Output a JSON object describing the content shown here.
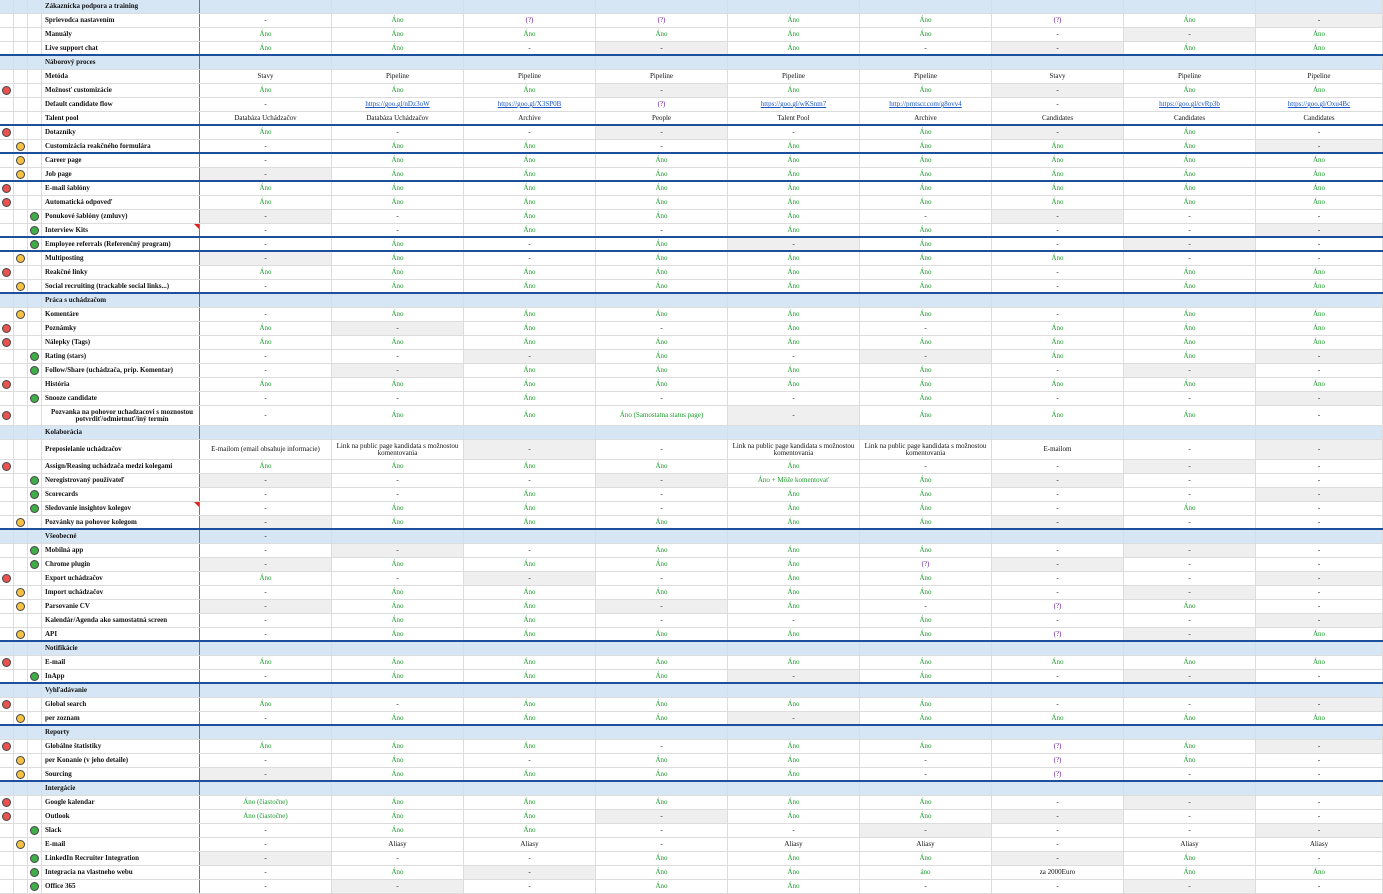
{
  "sheet": {
    "rows": [
      {
        "label": "Zákaznícka podpora a training",
        "section": true,
        "border": false,
        "values": []
      },
      {
        "label": "Sprievodca nastavením",
        "dot": "",
        "values": [
          "-",
          "Áno",
          "(?)",
          "(?)",
          "Áno",
          "Áno",
          "(?)",
          "Áno",
          "-"
        ]
      },
      {
        "label": "Manuály",
        "dot": "",
        "values": [
          "Áno",
          "Áno",
          "Áno",
          "Áno",
          "Áno",
          "Áno",
          "-",
          "-",
          "Áno"
        ]
      },
      {
        "label": "Live support chat",
        "dot": "",
        "border": true,
        "values": [
          "Áno",
          "Áno",
          "-",
          "-",
          "Áno",
          "-",
          "-",
          "Áno",
          "Áno"
        ]
      },
      {
        "label": "Náborový proces",
        "section": true,
        "values": []
      },
      {
        "label": "Metóda",
        "dot": "",
        "values": [
          "Stavy",
          "Pipeline",
          "Pipeline",
          "Pipeline",
          "Pipeline",
          "Pipeline",
          "Stavy",
          "Pipeline",
          "Pipeline"
        ]
      },
      {
        "label": "Možnosť customizácie",
        "dot": "red",
        "values": [
          "Áno",
          "Áno",
          "Áno",
          "-",
          "Áno",
          "Áno",
          "-",
          "Áno",
          "Áno"
        ]
      },
      {
        "label": "Default candidate flow",
        "dot": "",
        "values": [
          "-",
          "https://goo.gl/nDz3oW",
          "https://goo.gl/X3SP0B",
          "(?)",
          "https://goo.gl/wKSnm7",
          "http://prntscr.com/g8ovv4",
          "-",
          "https://goo.gl/cvRp3b",
          "https://goo.gl/Oxu4Bc"
        ]
      },
      {
        "label": "Talent pool",
        "dot": "",
        "border": true,
        "values": [
          "Databáza Uchádzačov",
          "Databáza Uchádzačov",
          "Archive",
          "People",
          "Talent Pool",
          "Archive",
          "Candidates",
          "Candidates",
          "Candidates"
        ]
      },
      {
        "label": "Dotazníky",
        "dot": "red",
        "values": [
          "Áno",
          "-",
          "-",
          "-",
          "-",
          "Áno",
          "-",
          "Áno",
          "-"
        ]
      },
      {
        "label": "Customizácia reakčného formulára",
        "dot": "yellow",
        "border": true,
        "values": [
          "-",
          "Áno",
          "Áno",
          "-",
          "Áno",
          "Áno",
          "Áno",
          "Áno",
          "-"
        ]
      },
      {
        "label": "Career page",
        "dot": "yellow",
        "values": [
          "-",
          "Áno",
          "Áno",
          "Áno",
          "Áno",
          "Áno",
          "Áno",
          "Áno",
          "Áno"
        ]
      },
      {
        "label": "Job page",
        "dot": "yellow",
        "border": true,
        "values": [
          "-",
          "Áno",
          "Áno",
          "Áno",
          "Áno",
          "Áno",
          "Áno",
          "Áno",
          "Áno"
        ]
      },
      {
        "label": "E-mail šablóny",
        "dot": "red",
        "values": [
          "Áno",
          "Áno",
          "Áno",
          "Áno",
          "Áno",
          "Áno",
          "Áno",
          "Áno",
          "Áno"
        ]
      },
      {
        "label": "Automatická odpoveď",
        "dot": "red",
        "values": [
          "Áno",
          "Áno",
          "Áno",
          "Áno",
          "Áno",
          "Áno",
          "Áno",
          "Áno",
          "Áno"
        ]
      },
      {
        "label": "Ponukové šablóny (zmluvy)",
        "dot": "green",
        "values": [
          "-",
          "-",
          "Áno",
          "Áno",
          "Áno",
          "-",
          "-",
          "-",
          "-"
        ]
      },
      {
        "label": "Interview Kits",
        "dot": "green",
        "comment": true,
        "border": true,
        "values": [
          "-",
          "-",
          "Áno",
          "-",
          "Áno",
          "Áno",
          "-",
          "-",
          "-"
        ]
      },
      {
        "label": "Employee referrals (Referenčný program)",
        "dot": "green",
        "border": true,
        "values": [
          "-",
          "Áno",
          "-",
          "Áno",
          "-",
          "Áno",
          "-",
          "-",
          "-"
        ]
      },
      {
        "label": "Multiposting",
        "dot": "yellow",
        "values": [
          "-",
          "Áno",
          "-",
          "Áno",
          "Áno",
          "Áno",
          "Áno",
          "-",
          "-"
        ]
      },
      {
        "label": "Reakčné linky",
        "dot": "red",
        "values": [
          "Áno",
          "Áno",
          "Áno",
          "Áno",
          "Áno",
          "Áno",
          "-",
          "Áno",
          "Áno"
        ]
      },
      {
        "label": "Social recruiting (trackable social links...)",
        "dot": "yellow",
        "border": true,
        "values": [
          "-",
          "Áno",
          "Áno",
          "Áno",
          "Áno",
          "Áno",
          "-",
          "Áno",
          "Áno"
        ]
      },
      {
        "label": "Práca s uchádzačom",
        "section": true,
        "values": []
      },
      {
        "label": "Komentáre",
        "dot": "yellow",
        "values": [
          "-",
          "Áno",
          "Áno",
          "Áno",
          "Áno",
          "Áno",
          "-",
          "Áno",
          "Áno"
        ]
      },
      {
        "label": "Poznámky",
        "dot": "red",
        "values": [
          "Áno",
          "-",
          "Áno",
          "-",
          "Áno",
          "-",
          "Áno",
          "Áno",
          "Áno"
        ]
      },
      {
        "label": "Nálepky (Tags)",
        "dot": "red",
        "values": [
          "Áno",
          "Áno",
          "Áno",
          "Áno",
          "Áno",
          "Áno",
          "Áno",
          "Áno",
          "Áno"
        ]
      },
      {
        "label": "Rating (stars)",
        "dot": "green",
        "values": [
          "-",
          "-",
          "-",
          "Áno",
          "-",
          "-",
          "Áno",
          "Áno",
          "-"
        ]
      },
      {
        "label": "Follow/Share (uchádzača, príp. Komentar)",
        "dot": "green",
        "values": [
          "-",
          "-",
          "Áno",
          "Áno",
          "Áno",
          "Áno",
          "-",
          "-",
          "-"
        ]
      },
      {
        "label": "História",
        "dot": "red",
        "values": [
          "Áno",
          "Áno",
          "Áno",
          "Áno",
          "Áno",
          "Áno",
          "Áno",
          "Áno",
          "Áno"
        ]
      },
      {
        "label": "Snooze candidate",
        "dot": "green",
        "values": [
          "-",
          "-",
          "Áno",
          "-",
          "-",
          "Áno",
          "-",
          "-",
          "-"
        ]
      },
      {
        "label": "Pozvanka na pohovor uchadzacovi s moznostou potvrdiť/odmietnuť/iný termín",
        "dot": "red",
        "tall": true,
        "values": [
          "-",
          "Áno",
          "Áno",
          "Áno (Samostatna status page)",
          "-",
          "Áno",
          "Áno",
          "Áno",
          "-"
        ]
      },
      {
        "label": "Kolaborácia",
        "section": true,
        "values": []
      },
      {
        "label": "Preposielanie uchádzačov",
        "dot": "",
        "tall": true,
        "values": [
          "E-mailom (email obsahuje informacie)",
          "Link na public page kandidata s možnostou komentovania",
          "-",
          "-",
          "Link na public page kandidata s možnostou komentovania",
          "Link na public page kandidata s možnostou komentovania",
          "E-mailom",
          "-",
          "-"
        ]
      },
      {
        "label": "Assign/Reasing uchádzača medzi kolegami",
        "dot": "red",
        "values": [
          "Áno",
          "Áno",
          "Áno",
          "Áno",
          "Áno",
          "-",
          "-",
          "-",
          "-"
        ]
      },
      {
        "label": "Neregistrovaný používateľ",
        "dot": "green",
        "values": [
          "-",
          "-",
          "-",
          "-",
          "Áno + Môže komentovať",
          "Áno",
          "-",
          "-",
          "-"
        ]
      },
      {
        "label": "Scorecards",
        "dot": "green",
        "values": [
          "-",
          "-",
          "Áno",
          "-",
          "Áno",
          "Áno",
          "-",
          "-",
          "-"
        ]
      },
      {
        "label": "Sledovanie insightov kolegov",
        "dot": "green",
        "comment": true,
        "values": [
          "-",
          "Áno",
          "Áno",
          "-",
          "Áno",
          "Áno",
          "-",
          "Áno",
          "-"
        ]
      },
      {
        "label": "Pozvánky na pohovor kolegom",
        "dot": "yellow",
        "border": true,
        "values": [
          "-",
          "Áno",
          "Áno",
          "Áno",
          "Áno",
          "Áno",
          "-",
          "-",
          "-"
        ]
      },
      {
        "label": "Všeobecné",
        "section": true,
        "values": [
          "-"
        ]
      },
      {
        "label": "Mobilná app",
        "dot": "green",
        "values": [
          "-",
          "-",
          "-",
          "Áno",
          "Áno",
          "Áno",
          "-",
          "-",
          "-"
        ]
      },
      {
        "label": "Chrome plugin",
        "dot": "green",
        "values": [
          "-",
          "Áno",
          "Áno",
          "Áno",
          "Áno",
          "(?)",
          "-",
          "-",
          "-"
        ]
      },
      {
        "label": "Export uchádzačov",
        "dot": "red",
        "values": [
          "Áno",
          "-",
          "-",
          "-",
          "Áno",
          "Áno",
          "-",
          "-",
          "-"
        ]
      },
      {
        "label": "Import uchádzačov",
        "dot": "yellow",
        "values": [
          "-",
          "Áno",
          "Áno",
          "Áno",
          "Áno",
          "Áno",
          "-",
          "-",
          "-"
        ]
      },
      {
        "label": "Parsovanie CV",
        "dot": "yellow",
        "values": [
          "-",
          "Áno",
          "Áno",
          "-",
          "Áno",
          "-",
          "(?)",
          "Áno",
          "-"
        ]
      },
      {
        "label": "Kalendár/Agenda ako samostatná screen",
        "dot": "",
        "values": [
          "-",
          "Áno",
          "Áno",
          "-",
          "-",
          "Áno",
          "-",
          "-",
          "-"
        ]
      },
      {
        "label": "API",
        "dot": "yellow",
        "border": true,
        "values": [
          "-",
          "Áno",
          "Áno",
          "Áno",
          "Áno",
          "Áno",
          "(?)",
          "-",
          "Áno"
        ]
      },
      {
        "label": "Notifikácie",
        "section": true,
        "values": []
      },
      {
        "label": "E-mail",
        "dot": "red",
        "values": [
          "Áno",
          "Áno",
          "Áno",
          "Áno",
          "Áno",
          "Áno",
          "Áno",
          "Áno",
          "Áno"
        ]
      },
      {
        "label": "InApp",
        "dot": "green",
        "border": true,
        "values": [
          "-",
          "Áno",
          "Áno",
          "Áno",
          "-",
          "Áno",
          "-",
          "-",
          "-"
        ]
      },
      {
        "label": "Vyhľadávanie",
        "section": true,
        "values": []
      },
      {
        "label": "Global search",
        "dot": "red",
        "values": [
          "Áno",
          "-",
          "Áno",
          "Áno",
          "Áno",
          "Áno",
          "-",
          "-",
          "-"
        ]
      },
      {
        "label": "per zoznam",
        "dot": "yellow",
        "border": true,
        "values": [
          "-",
          "Áno",
          "Áno",
          "Áno",
          "-",
          "Áno",
          "Áno",
          "Áno",
          "Áno"
        ]
      },
      {
        "label": "Reporty",
        "section": true,
        "values": []
      },
      {
        "label": "Globálne štatistiky",
        "dot": "red",
        "values": [
          "Áno",
          "Áno",
          "Áno",
          "-",
          "Áno",
          "Áno",
          "(?)",
          "Áno",
          "-"
        ]
      },
      {
        "label": "per Konanie (v jeho detaile)",
        "dot": "yellow",
        "values": [
          "-",
          "Áno",
          "-",
          "Áno",
          "Áno",
          "-",
          "(?)",
          "Áno",
          "-"
        ]
      },
      {
        "label": "Sourcing",
        "dot": "yellow",
        "border": true,
        "values": [
          "-",
          "Áno",
          "Áno",
          "Áno",
          "Áno",
          "-",
          "(?)",
          "-",
          "-"
        ]
      },
      {
        "label": "Intergácie",
        "section": true,
        "values": []
      },
      {
        "label": "Google kalendar",
        "dot": "red",
        "values": [
          "Áno (čiastočne)",
          "Áno",
          "Áno",
          "Áno",
          "Áno",
          "Áno",
          "-",
          "-",
          "-"
        ]
      },
      {
        "label": "Outlook",
        "dot": "red",
        "values": [
          "Áno (čiastočne)",
          "Áno",
          "Áno",
          "-",
          "Áno",
          "Áno",
          "-",
          "-",
          "-"
        ]
      },
      {
        "label": "Slack",
        "dot": "green",
        "values": [
          "-",
          "Áno",
          "Áno",
          "-",
          "-",
          "-",
          "-",
          "-",
          "-"
        ]
      },
      {
        "label": "E-mail",
        "dot": "yellow",
        "values": [
          "-",
          "Aliasy",
          "Aliasy",
          "-",
          "Aliasy",
          "Aliasy",
          "-",
          "Aliasy",
          "Aliasy"
        ]
      },
      {
        "label": "LinkedIn Recruiter Integration",
        "dot": "green",
        "values": [
          "-",
          "-",
          "-",
          "Áno",
          "Áno",
          "Áno",
          "-",
          "Áno",
          "-"
        ]
      },
      {
        "label": "Integracia na vlastneho webu",
        "dot": "green",
        "values": [
          "-",
          "Áno",
          "-",
          "Áno",
          "Áno",
          "áno",
          "za 2000Euro",
          "Áno",
          "Áno"
        ]
      },
      {
        "label": "Office 365",
        "dot": "green",
        "values": [
          "-",
          "-",
          "-",
          "Áno",
          "Áno",
          "-",
          "-",
          "-",
          "-"
        ]
      }
    ]
  }
}
